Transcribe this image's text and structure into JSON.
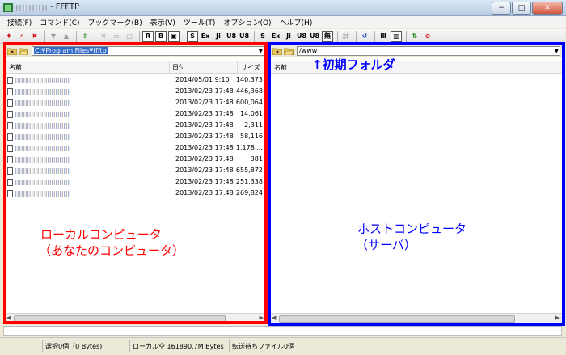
{
  "window": {
    "title": "- FFFTP",
    "buttons": {
      "minimize": "−",
      "maximize": "□",
      "close": "✕"
    }
  },
  "menu": [
    "接続(F)",
    "コマンド(C)",
    "ブックマーク(B)",
    "表示(V)",
    "ツール(T)",
    "オプション(O)",
    "ヘルプ(H)"
  ],
  "toolbar": {
    "items": [
      {
        "icon": "connect-icon",
        "glyph": "♦"
      },
      {
        "icon": "quick-connect-icon",
        "glyph": "⚡"
      },
      {
        "icon": "disconnect-icon",
        "glyph": "✖"
      },
      {
        "sep": true
      },
      {
        "icon": "download-icon",
        "glyph": "▼",
        "disabled": true
      },
      {
        "icon": "upload-icon",
        "glyph": "▲",
        "disabled": true
      },
      {
        "sep": true
      },
      {
        "icon": "mirror-upload-icon",
        "glyph": "⇧"
      },
      {
        "sep": true
      },
      {
        "icon": "delete-icon",
        "glyph": "✕",
        "disabled": true
      },
      {
        "icon": "rename-icon",
        "glyph": "▭",
        "disabled": true
      },
      {
        "icon": "mkdir-icon",
        "glyph": "▢",
        "disabled": true
      },
      {
        "sep": true
      },
      {
        "icon": "local-root-icon",
        "glyph": "R",
        "boxed": true
      },
      {
        "icon": "bookmark-icon",
        "glyph": "B",
        "boxed": true
      },
      {
        "icon": "list-icon",
        "glyph": "▣",
        "boxed": true
      },
      {
        "sep": true
      },
      {
        "icon": "sort-icon",
        "glyph": "S",
        "boxed": true
      },
      {
        "icon": "extension-icon",
        "glyph": "Ex"
      },
      {
        "icon": "jis-icon",
        "glyph": "Ji"
      },
      {
        "icon": "utf8-icon",
        "glyph": "U8"
      },
      {
        "icon": "utf8n-icon",
        "glyph": "U8"
      },
      {
        "sep": true
      },
      {
        "icon": "sjis-icon",
        "glyph": "S"
      },
      {
        "icon": "euc-icon",
        "glyph": "Ex"
      },
      {
        "icon": "jis-remote-icon",
        "glyph": "Ji"
      },
      {
        "icon": "utf8-remote-icon",
        "glyph": "U8"
      },
      {
        "icon": "utf8n-remote-icon",
        "glyph": "U8"
      },
      {
        "icon": "kana-icon",
        "glyph": "無",
        "boxed": true
      },
      {
        "sep": true
      },
      {
        "icon": "kana-convert-icon",
        "glyph": "ｶﾅ",
        "disabled": true
      },
      {
        "sep": true
      },
      {
        "icon": "refresh-icon",
        "glyph": "↺"
      },
      {
        "sep": true
      },
      {
        "icon": "list-view-icon",
        "glyph": "Ⅲ"
      },
      {
        "icon": "detail-view-icon",
        "glyph": "▥",
        "boxed": true
      },
      {
        "sep": true
      },
      {
        "icon": "sync-icon",
        "glyph": "⇅"
      },
      {
        "icon": "stop-icon",
        "glyph": "⊘"
      }
    ]
  },
  "local": {
    "path": "C:¥Program Files¥ffftp",
    "columns": {
      "name": "名前",
      "date": "日付",
      "size": "サイズ"
    },
    "files": [
      {
        "date": "2014/05/01  9:10",
        "size": "140,373"
      },
      {
        "date": "2013/02/23 17:48",
        "size": "446,368"
      },
      {
        "date": "2013/02/23 17:48",
        "size": "600,064"
      },
      {
        "date": "2013/02/23 17:48",
        "size": "14,061"
      },
      {
        "date": "2013/02/23 17:48",
        "size": "2,311"
      },
      {
        "date": "2013/02/23 17:48",
        "size": "58,116"
      },
      {
        "date": "2013/02/23 17:48",
        "size": "1,178,..."
      },
      {
        "date": "2013/02/23 17:48",
        "size": "381"
      },
      {
        "date": "2013/02/23 17:48",
        "size": "655,872"
      },
      {
        "date": "2013/02/23 17:48",
        "size": "251,338"
      },
      {
        "date": "2013/02/23 17:48",
        "size": "269,824"
      }
    ]
  },
  "remote": {
    "path": "/www",
    "columns": {
      "name": "名前"
    }
  },
  "annotations": {
    "initial_folder": "↑初期フォルダ",
    "local_line1": "ローカルコンピュータ",
    "local_line2": "（あなたのコンピュータ）",
    "remote_line1": "ホストコンピュータ",
    "remote_line2": "（サーバ）",
    "local_frame_color": "#ff0000",
    "remote_frame_color": "#0000ff"
  },
  "status": {
    "selected": "選択0個（0 Bytes)",
    "local_free": "ローカル空 161890.7M Bytes",
    "queue": "転送待ちファイル0個"
  }
}
